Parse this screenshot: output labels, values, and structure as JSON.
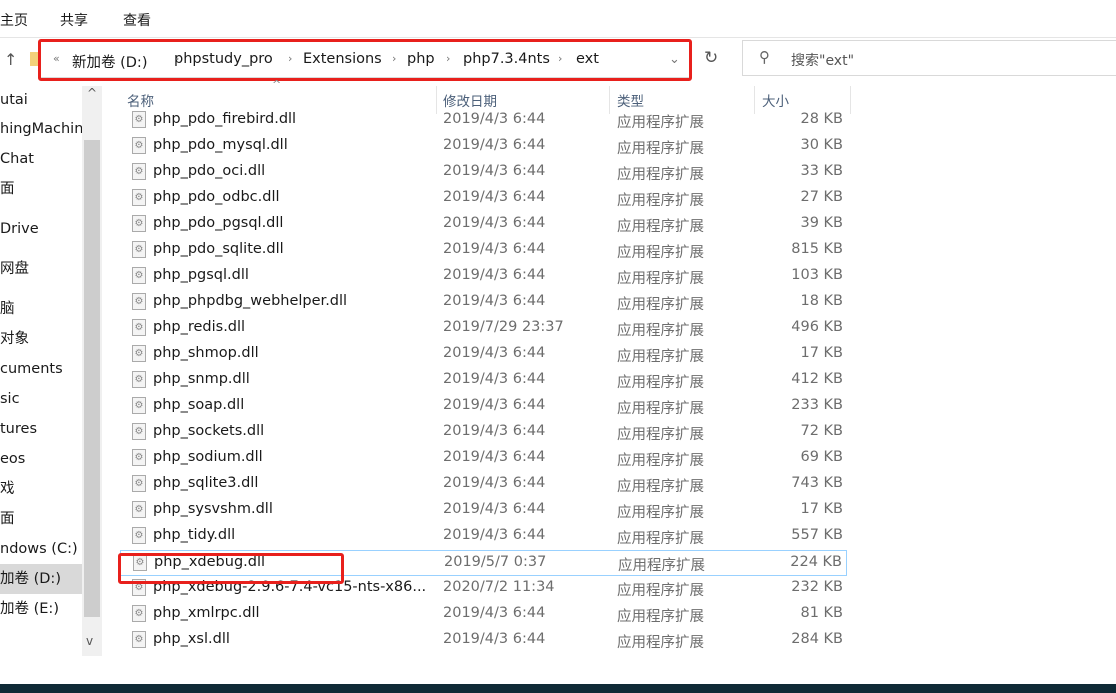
{
  "ribbon": {
    "tabs": [
      "主页",
      "共享",
      "查看"
    ]
  },
  "address": {
    "prefix": "«",
    "crumbs": [
      "新加卷 (D:)",
      "phpstudy_pro",
      "Extensions",
      "php",
      "php7.3.4nts",
      "ext"
    ]
  },
  "search": {
    "placeholder": "搜索\"ext\""
  },
  "nav": {
    "items": [
      "utai",
      "hingMachin",
      "Chat",
      "面",
      "Drive",
      "网盘",
      "脑",
      "对象",
      "cuments",
      "sic",
      "tures",
      "eos",
      "戏",
      "面",
      "ndows (C:)",
      "加卷 (D:)",
      "加卷 (E:)"
    ],
    "selected": "加卷 (D:)"
  },
  "columns": {
    "name": "名称",
    "date": "修改日期",
    "type": "类型",
    "size": "大小"
  },
  "files": [
    {
      "name": "php_pdo_firebird.dll",
      "date": "2019/4/3 6:44",
      "type": "应用程序扩展",
      "size": "28 KB"
    },
    {
      "name": "php_pdo_mysql.dll",
      "date": "2019/4/3 6:44",
      "type": "应用程序扩展",
      "size": "30 KB"
    },
    {
      "name": "php_pdo_oci.dll",
      "date": "2019/4/3 6:44",
      "type": "应用程序扩展",
      "size": "33 KB"
    },
    {
      "name": "php_pdo_odbc.dll",
      "date": "2019/4/3 6:44",
      "type": "应用程序扩展",
      "size": "27 KB"
    },
    {
      "name": "php_pdo_pgsql.dll",
      "date": "2019/4/3 6:44",
      "type": "应用程序扩展",
      "size": "39 KB"
    },
    {
      "name": "php_pdo_sqlite.dll",
      "date": "2019/4/3 6:44",
      "type": "应用程序扩展",
      "size": "815 KB"
    },
    {
      "name": "php_pgsql.dll",
      "date": "2019/4/3 6:44",
      "type": "应用程序扩展",
      "size": "103 KB"
    },
    {
      "name": "php_phpdbg_webhelper.dll",
      "date": "2019/4/3 6:44",
      "type": "应用程序扩展",
      "size": "18 KB"
    },
    {
      "name": "php_redis.dll",
      "date": "2019/7/29 23:37",
      "type": "应用程序扩展",
      "size": "496 KB"
    },
    {
      "name": "php_shmop.dll",
      "date": "2019/4/3 6:44",
      "type": "应用程序扩展",
      "size": "17 KB"
    },
    {
      "name": "php_snmp.dll",
      "date": "2019/4/3 6:44",
      "type": "应用程序扩展",
      "size": "412 KB"
    },
    {
      "name": "php_soap.dll",
      "date": "2019/4/3 6:44",
      "type": "应用程序扩展",
      "size": "233 KB"
    },
    {
      "name": "php_sockets.dll",
      "date": "2019/4/3 6:44",
      "type": "应用程序扩展",
      "size": "72 KB"
    },
    {
      "name": "php_sodium.dll",
      "date": "2019/4/3 6:44",
      "type": "应用程序扩展",
      "size": "69 KB"
    },
    {
      "name": "php_sqlite3.dll",
      "date": "2019/4/3 6:44",
      "type": "应用程序扩展",
      "size": "743 KB"
    },
    {
      "name": "php_sysvshm.dll",
      "date": "2019/4/3 6:44",
      "type": "应用程序扩展",
      "size": "17 KB"
    },
    {
      "name": "php_tidy.dll",
      "date": "2019/4/3 6:44",
      "type": "应用程序扩展",
      "size": "557 KB"
    },
    {
      "name": "php_xdebug.dll",
      "date": "2019/5/7 0:37",
      "type": "应用程序扩展",
      "size": "224 KB",
      "focused": true
    },
    {
      "name": "php_xdebug-2.9.6-7.4-vc15-nts-x86...",
      "date": "2020/7/2 11:34",
      "type": "应用程序扩展",
      "size": "232 KB"
    },
    {
      "name": "php_xmlrpc.dll",
      "date": "2019/4/3 6:44",
      "type": "应用程序扩展",
      "size": "81 KB"
    },
    {
      "name": "php_xsl.dll",
      "date": "2019/4/3 6:44",
      "type": "应用程序扩展",
      "size": "284 KB"
    }
  ],
  "colors": {
    "highlight": "#e8201c",
    "focus_border": "#99d1ff",
    "nav_selected": "#d9d9d9",
    "taskbar": "#0f2a36"
  }
}
